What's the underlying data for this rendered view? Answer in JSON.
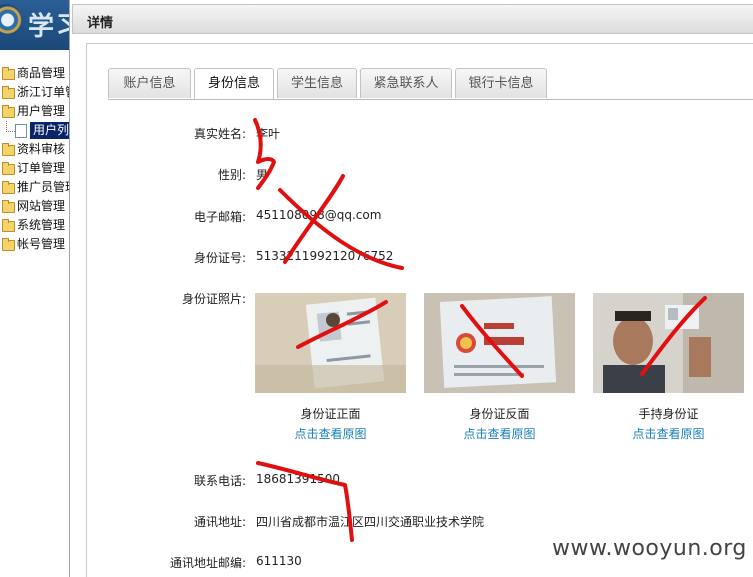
{
  "app": {
    "logo_text": "学习"
  },
  "sidebar": {
    "items": [
      {
        "label": "商品管理"
      },
      {
        "label": "浙江订单管"
      },
      {
        "label": "用户管理"
      },
      {
        "label": "资料审核"
      },
      {
        "label": "订单管理"
      },
      {
        "label": "推广员管理"
      },
      {
        "label": "网站管理"
      },
      {
        "label": "系统管理"
      },
      {
        "label": "帐号管理"
      }
    ],
    "sub_item": {
      "label": "用户列"
    }
  },
  "panel": {
    "title": "详情"
  },
  "tabs": [
    {
      "label": "账户信息"
    },
    {
      "label": "身份信息"
    },
    {
      "label": "学生信息"
    },
    {
      "label": "紧急联系人"
    },
    {
      "label": "银行卡信息"
    }
  ],
  "active_tab": "身份信息",
  "fields": {
    "name": {
      "label": "真实姓名:",
      "value": "李叶"
    },
    "gender": {
      "label": "性别:",
      "value": "男"
    },
    "email": {
      "label": "电子邮箱:",
      "value": "451108098@qq.com"
    },
    "id_number": {
      "label": "身份证号:",
      "value": "513321199212076752"
    },
    "id_photos": {
      "label": "身份证照片:"
    },
    "phone": {
      "label": "联系电话:",
      "value": "18681391500"
    },
    "address": {
      "label": "通讯地址:",
      "value": "四川省成都市温江区四川交通职业技术学院"
    },
    "postcode": {
      "label": "通讯地址邮编:",
      "value": "611130"
    }
  },
  "photos": [
    {
      "caption": "身份证正面",
      "link": "点击查看原图"
    },
    {
      "caption": "身份证反面",
      "link": "点击查看原图"
    },
    {
      "caption": "手持身份证",
      "link": "点击查看原图"
    }
  ],
  "watermark": "www.wooyun.org",
  "colors": {
    "link": "#1a7fb8",
    "redaction": "#e01010",
    "selected": "#0a246a"
  }
}
